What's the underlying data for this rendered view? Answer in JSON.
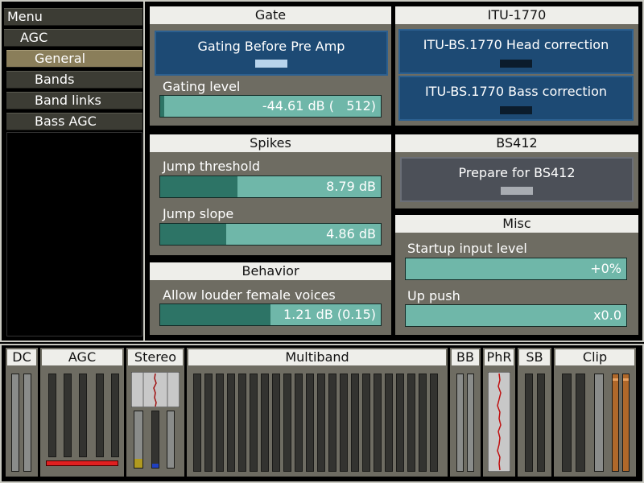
{
  "menu": {
    "title": "Menu",
    "items": [
      {
        "label": "AGC",
        "selected": false
      },
      {
        "label": "General",
        "selected": true
      },
      {
        "label": "Bands",
        "selected": false
      },
      {
        "label": "Band links",
        "selected": false
      },
      {
        "label": "Bass AGC",
        "selected": false
      }
    ]
  },
  "gate": {
    "title": "Gate",
    "gating_before_preamp": "Gating Before Pre Amp",
    "gating_level_label": "Gating level",
    "gating_level_value": "-44.61 dB (   512)",
    "gating_level_fraction": 0.02
  },
  "itu": {
    "title": "ITU-1770",
    "head_correction": "ITU-BS.1770 Head correction",
    "bass_correction": "ITU-BS.1770 Bass correction"
  },
  "spikes": {
    "title": "Spikes",
    "jump_threshold_label": "Jump threshold",
    "jump_threshold_value": "8.79 dB",
    "jump_threshold_fraction": 0.35,
    "jump_slope_label": "Jump slope",
    "jump_slope_value": "4.86 dB",
    "jump_slope_fraction": 0.3
  },
  "bs412": {
    "title": "BS412",
    "prepare": "Prepare for BS412"
  },
  "behavior": {
    "title": "Behavior",
    "female_label": "Allow louder female voices",
    "female_value": "1.21 dB (0.15)",
    "female_fraction": 0.5
  },
  "misc": {
    "title": "Misc",
    "startup_label": "Startup input level",
    "startup_value": "+0%",
    "up_push_label": "Up push",
    "up_push_value": "x0.0"
  },
  "meters": {
    "dc": "DC",
    "agc": "AGC",
    "stereo": "Stereo",
    "multiband": "Multiband",
    "bb": "BB",
    "phr": "PhR",
    "sb": "SB",
    "clip": "Clip"
  },
  "colors": {
    "slider_fill": "#2d7466",
    "slider_track": "#6fb7a9",
    "button_blue": "#1d4a74",
    "panel_bg": "#6e6c62",
    "agc_red": "#e02020",
    "clip_orange": "#b0682a"
  }
}
